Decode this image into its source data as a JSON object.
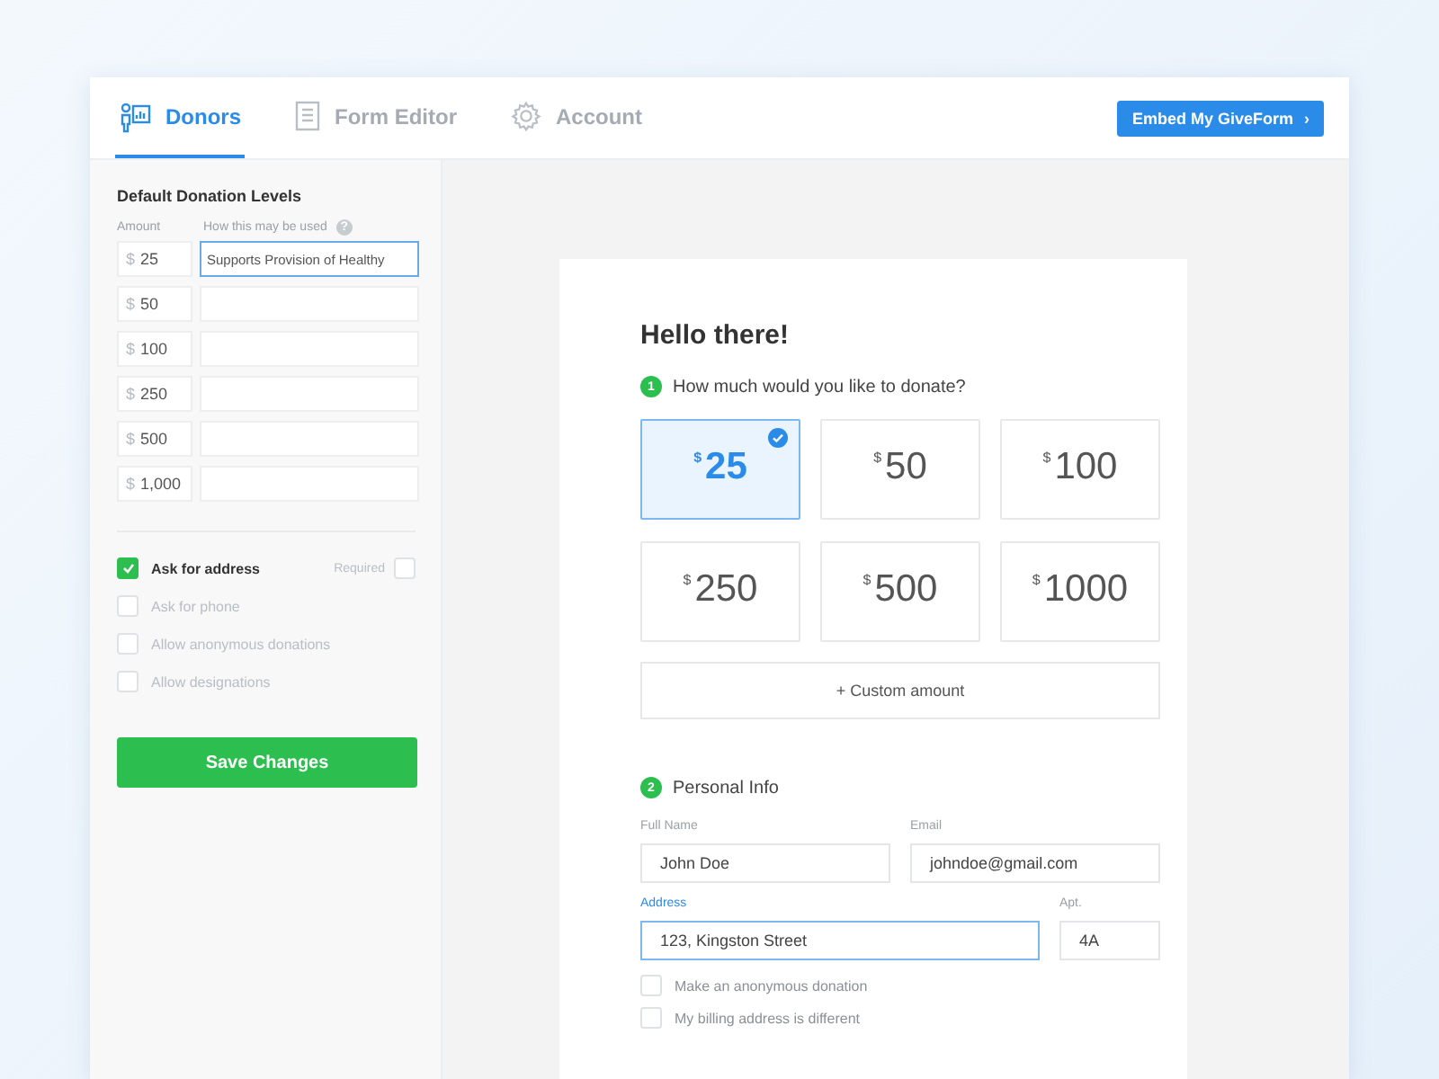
{
  "tabs": [
    {
      "label": "Donors",
      "selected": true
    },
    {
      "label": "Form Editor",
      "selected": false
    },
    {
      "label": "Account",
      "selected": false
    }
  ],
  "embed_button": {
    "label": "Embed My GiveForm",
    "caret": "›"
  },
  "sidebar": {
    "title": "Default Donation Levels",
    "amount_header": "Amount",
    "usage_header": "How this may be used",
    "help": "?",
    "currency": "$",
    "levels": [
      {
        "amount": "25",
        "usage": "Supports Provision of Healthy",
        "focused": true
      },
      {
        "amount": "50",
        "focused": false
      },
      {
        "amount": "100",
        "focused": false
      },
      {
        "amount": "250",
        "focused": false
      },
      {
        "amount": "500",
        "focused": false
      },
      {
        "amount": "1,000",
        "focused": false
      }
    ],
    "options": [
      {
        "label": "Ask for address",
        "checked": true,
        "required_label": "Required",
        "required": false
      },
      {
        "label": "Ask for phone",
        "checked": false
      },
      {
        "label": "Allow anonymous donations",
        "checked": false
      },
      {
        "label": "Allow designations",
        "checked": false
      }
    ],
    "save_button": "Save Changes"
  },
  "form": {
    "title": "Hello there!",
    "step1": {
      "number": "1",
      "label": "How much would you like to donate?"
    },
    "currency": "$",
    "amounts": [
      {
        "value": "25",
        "selected": true
      },
      {
        "value": "50",
        "selected": false
      },
      {
        "value": "100",
        "selected": false
      },
      {
        "value": "250",
        "selected": false
      },
      {
        "value": "500",
        "selected": false
      },
      {
        "value": "1000",
        "selected": false
      }
    ],
    "custom_amount": "+  Custom amount",
    "step2": {
      "number": "2",
      "label": "Personal Info"
    },
    "fields": [
      {
        "label": "Full Name",
        "value": "John Doe",
        "focused": false
      },
      {
        "label": "Email",
        "value": "johndoe@gmail.com",
        "focused": false
      },
      {
        "label": "Address",
        "value": "123, Kingston Street",
        "focused": true
      },
      {
        "label": "Apt.",
        "value": "4A",
        "focused": false
      }
    ],
    "checks": [
      {
        "label": "Make an anonymous donation",
        "checked": false
      },
      {
        "label": "My billing address is different",
        "checked": false
      }
    ]
  }
}
